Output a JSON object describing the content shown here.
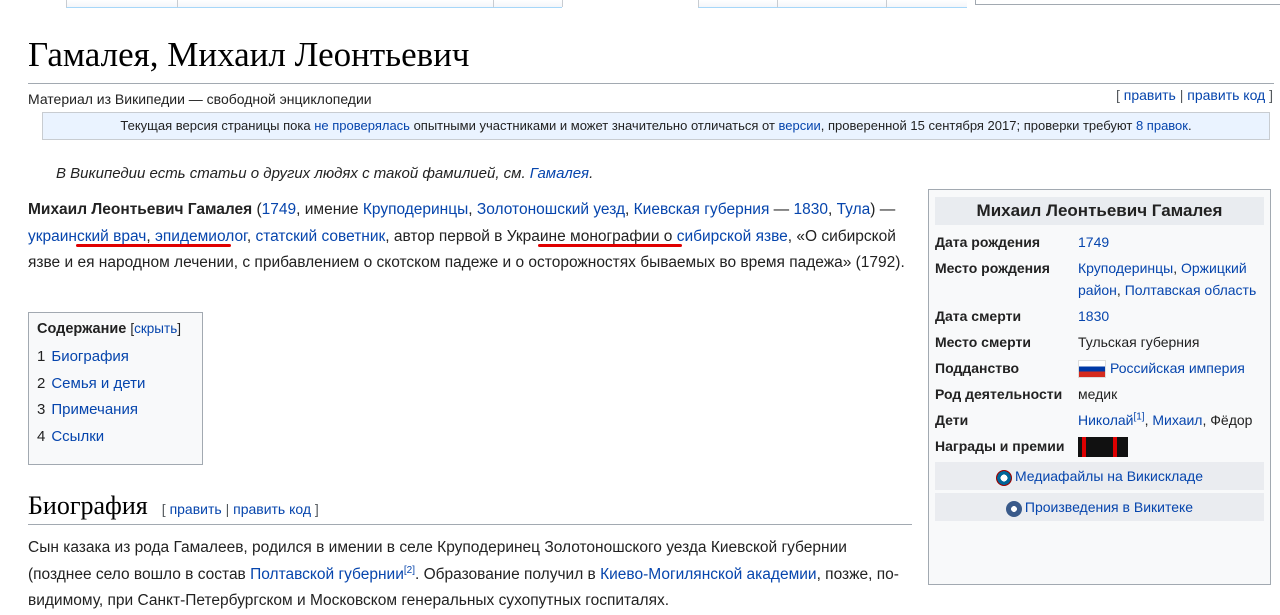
{
  "title": "Гамалея, Михаил Леонтьевич",
  "tagline": "Материал из Википедии — свободной энциклопедии",
  "edit_links": {
    "edit": "править",
    "edit_source": "править код"
  },
  "notice": {
    "prefix": "Текущая версия страницы пока ",
    "link1": "не проверялась",
    "middle": " опытными участниками и может значительно отличаться от ",
    "link2": "версии",
    "suffix": ", проверенной 15 сентября 2017; проверки требуют ",
    "link3": "8 правок",
    "end": "."
  },
  "hatnote": {
    "text": "В Википедии есть статьи о других людях с такой фамилией, см. ",
    "link": "Гамалея",
    "end": "."
  },
  "lead": {
    "bold": "Михаил Леонтьевич Гамалея",
    "p1": " (",
    "birth_year": "1749",
    "p2": ", имение ",
    "village": "Круподеринцы",
    "comma1": ", ",
    "uezd": "Золотоношский уезд",
    "comma2": ", ",
    "gubernia": "Киевская губерния",
    "p3": " — ",
    "death_year": "1830",
    "comma3": ", ",
    "tula": "Тула",
    "p4": ") — ",
    "ukr": "украинский",
    "space1": " ",
    "doctor": "врач",
    "comma4": ", ",
    "epid": "эпидемиолог",
    "comma5": ", ",
    "counsellor": "статский советник",
    "p5": ", автор ",
    "first": "первой в Украине",
    "p6": " монографии о ",
    "anthrax": "сибирской язве",
    "p7": ", «О сибирской язве и ея народном лечении, с прибавлением о скотском падеже и о осторожностях бываемых во время падежа» (1792)."
  },
  "toc": {
    "heading": "Содержание",
    "hide": "скрыть",
    "items": [
      {
        "num": "1",
        "label": "Биография"
      },
      {
        "num": "2",
        "label": "Семья и дети"
      },
      {
        "num": "3",
        "label": "Примечания"
      },
      {
        "num": "4",
        "label": "Ссылки"
      }
    ]
  },
  "section": {
    "title": "Биография",
    "edit": "править",
    "edit_source": "править код"
  },
  "bio": {
    "p1": "Сын казака из рода Гамалеев, родился в имении в селе Круподеринец Золотоношского уезда Киевской губернии (позднее село вошло в состав ",
    "link1": "Полтавской губернии",
    "ref1": "[2]",
    "p2": ". Образование получил в ",
    "link2": "Киево-Могилянской академии",
    "p3": ", позже, по-видимому, при Санкт-Петербургском и Московском генеральных сухопутных госпиталях."
  },
  "infobox": {
    "title": "Михаил Леонтьевич Гамалея",
    "rows": {
      "birth_date": {
        "label": "Дата рождения",
        "value": "1749"
      },
      "birth_place": {
        "label": "Место рождения",
        "v1": "Круподеринцы",
        "sep": ", ",
        "v2": "Оржицкий район",
        "sep2": ", ",
        "v3": "Полтавская область"
      },
      "death_date": {
        "label": "Дата смерти",
        "value": "1830"
      },
      "death_place": {
        "label": "Место смерти",
        "value": "Тульская губерния"
      },
      "citizenship": {
        "label": "Подданство",
        "value": "Российская империя"
      },
      "occupation": {
        "label": "Род деятельности",
        "value": "медик"
      },
      "children": {
        "label": "Дети",
        "v1": "Николай",
        "ref": "[1]",
        "sep": ", ",
        "v2": "Михаил",
        "sep2": ", ",
        "v3": "Фёдор"
      },
      "awards": {
        "label": "Награды и премии"
      }
    },
    "commons": "Медиафайлы на Викискладе",
    "wikisource": "Произведения в Викитеке"
  }
}
